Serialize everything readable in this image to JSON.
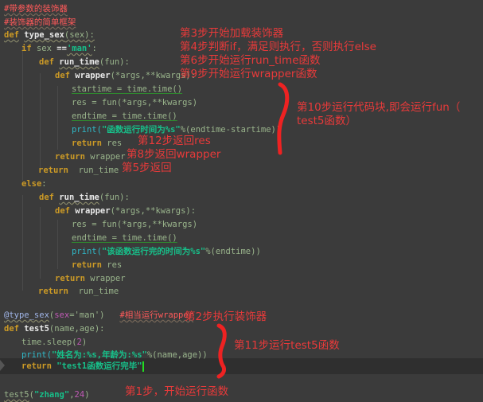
{
  "code": {
    "comment1": "#带参数的装饰器",
    "comment2": "#装饰器的简单框架",
    "line_def_type_sex": {
      "kw": "def",
      "name": "type_sex",
      "param": "sex"
    },
    "line_if": {
      "kw": "if",
      "var": "sex",
      "op": "==",
      "str": "'man'"
    },
    "kw_def": "def",
    "kw_return": "return",
    "kw_else": "else",
    "run_time": "run_time",
    "fun": "fun",
    "wrapper": "wrapper",
    "args": "*args,**kwargs",
    "startime_line": "startime = time.time()",
    "res_line": "res = fun(*args,**kwargs)",
    "endtime_line": "endtime = time.time()",
    "print1_fn": "print",
    "print1_str": "\"函数运行时间为%s\"",
    "print1_rest": "%(endtime-startime))",
    "res": "res",
    "print2_str": "\"该函数运行完的时间为%s\"",
    "print2_rest": "%(endtime))",
    "decorator": "@type_sex",
    "decorator_arg": "sex",
    "decorator_val": "'man'",
    "decorator_comment": "#相当运行wrapper",
    "test5_name": "test5",
    "test5_params": "name,age",
    "sleep_line": "time.sleep(",
    "sleep_num": "2",
    "print3_str": "\"姓名为:%s,年龄为:%s\"",
    "print3_rest": "%(name,age))",
    "return_str": "\"test1函数运行完毕\"",
    "call_fn": "test5",
    "call_str": "\"zhang\"",
    "call_num": "24"
  },
  "annotations": {
    "step3": "第3步开始加载装饰器",
    "step4": "第4步判断if，满足则执行，否则执行else",
    "step6": "第6步开始运行run_time函数",
    "step9": "第9步开始运行wrapper函数",
    "step10": "第10步运行代码块,即会运行fun（\ntest5函数）",
    "step12": "第12步返回res",
    "step8": "第8步返回wrapper",
    "step5": "第5步返回",
    "step2": "第2步执行装饰器",
    "step11": "第11步运行test5函数",
    "step1": "第1步，开始运行函数"
  },
  "colors": {
    "background": "#3b3b3b",
    "annotation": "#e83a3a",
    "keyword": "#cc9a26",
    "string": "#17c08a"
  }
}
